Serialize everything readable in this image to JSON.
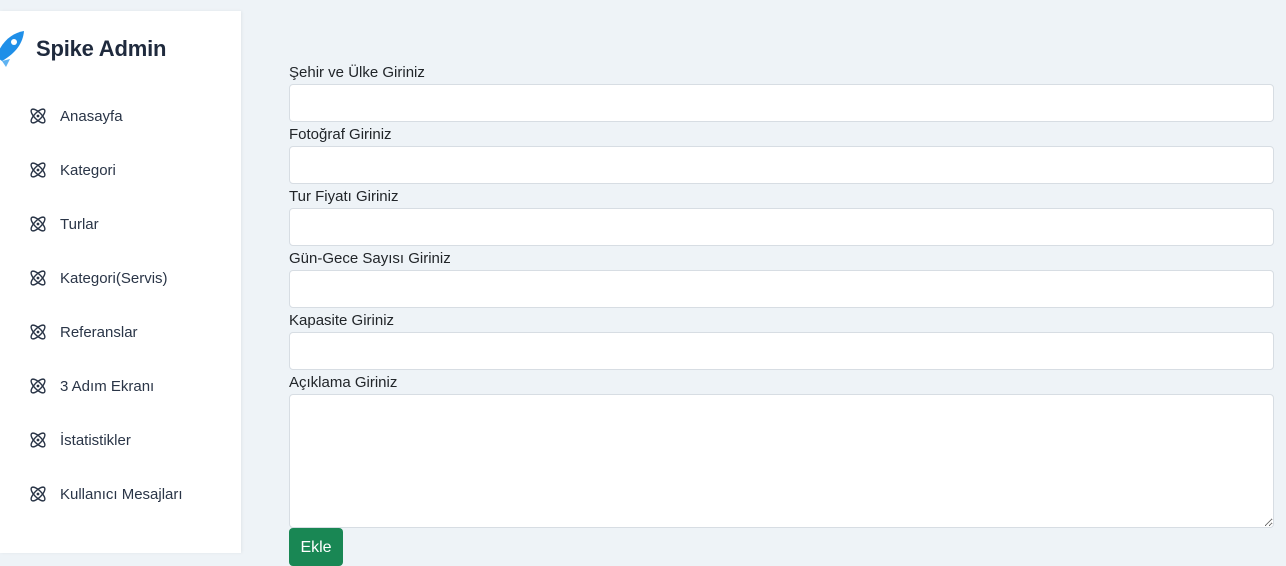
{
  "brand": {
    "name": "Spike Admin",
    "icon": "rocket-icon",
    "accent": "#1f8fe8"
  },
  "sidebar": {
    "items": [
      {
        "label": "Anasayfa",
        "icon": "atom-icon"
      },
      {
        "label": "Kategori",
        "icon": "atom-icon"
      },
      {
        "label": "Turlar",
        "icon": "atom-icon"
      },
      {
        "label": "Kategori(Servis)",
        "icon": "atom-icon"
      },
      {
        "label": "Referanslar",
        "icon": "atom-icon"
      },
      {
        "label": "3 Adım Ekranı",
        "icon": "atom-icon"
      },
      {
        "label": "İstatistikler",
        "icon": "atom-icon"
      },
      {
        "label": "Kullanıcı Mesajları",
        "icon": "atom-icon"
      }
    ]
  },
  "form": {
    "fields": [
      {
        "label": "Şehir ve Ülke Giriniz",
        "value": ""
      },
      {
        "label": "Fotoğraf Giriniz",
        "value": ""
      },
      {
        "label": "Tur Fiyatı Giriniz",
        "value": ""
      },
      {
        "label": "Gün-Gece Sayısı Giriniz",
        "value": ""
      },
      {
        "label": "Kapasite Giriniz",
        "value": ""
      }
    ],
    "description": {
      "label": "Açıklama Giriniz",
      "value": ""
    },
    "submit_label": "Ekle",
    "submit_color": "#198754"
  }
}
